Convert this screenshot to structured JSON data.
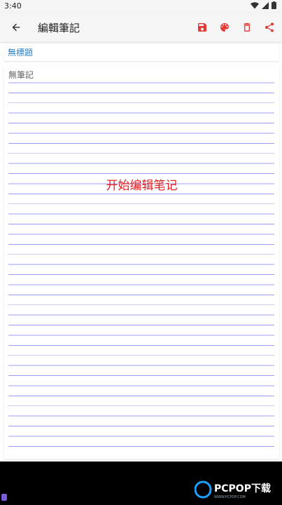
{
  "status_bar": {
    "time": "3:40"
  },
  "app_bar": {
    "title": "編輯筆記"
  },
  "editor": {
    "title_placeholder": "無標題",
    "note_placeholder": "無筆記",
    "hint": "开始编辑笔记"
  },
  "watermark": {
    "text": "PCPOP下载",
    "sub": "WWW.PCPOP.COM"
  },
  "colors": {
    "accent": "#e53935",
    "title_text": "#2f84c8",
    "ruled_line": "#9c9cf2",
    "hint_text": "#e02020"
  },
  "icons": {
    "back": "arrow-left-icon",
    "save": "save-icon",
    "palette": "palette-icon",
    "delete": "trash-icon",
    "share": "share-icon"
  }
}
